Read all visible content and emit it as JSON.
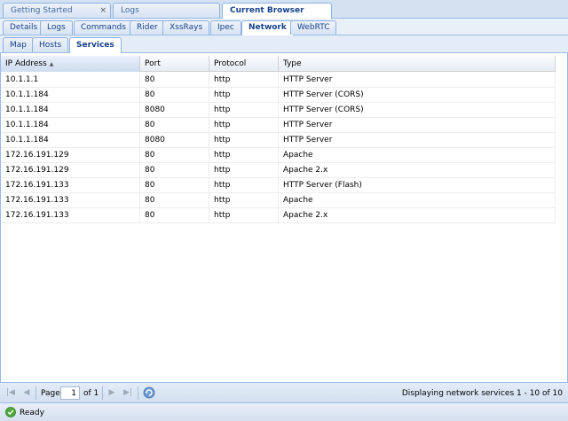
{
  "top_tabs": [
    {
      "label": "Getting Started",
      "close": "×"
    },
    {
      "label": "Logs"
    },
    {
      "label": "Current Browser"
    }
  ],
  "sub_tabs": [
    "Details",
    "Logs",
    "Commands",
    "Rider",
    "XssRays",
    "Ipec",
    "Network",
    "WebRTC"
  ],
  "section_tabs": [
    "Map",
    "Hosts",
    "Services"
  ],
  "grid": {
    "columns": [
      "IP Address",
      "Port",
      "Protocol",
      "Type"
    ],
    "sort_indicator": "▲",
    "rows": [
      [
        "10.1.1.1",
        "80",
        "http",
        "HTTP Server"
      ],
      [
        "10.1.1.184",
        "80",
        "http",
        "HTTP Server (CORS)"
      ],
      [
        "10.1.1.184",
        "8080",
        "http",
        "HTTP Server (CORS)"
      ],
      [
        "10.1.1.184",
        "80",
        "http",
        "HTTP Server"
      ],
      [
        "10.1.1.184",
        "8080",
        "http",
        "HTTP Server"
      ],
      [
        "172.16.191.129",
        "80",
        "http",
        "Apache"
      ],
      [
        "172.16.191.129",
        "80",
        "http",
        "Apache 2.x"
      ],
      [
        "172.16.191.133",
        "80",
        "http",
        "HTTP Server (Flash)"
      ],
      [
        "172.16.191.133",
        "80",
        "http",
        "Apache"
      ],
      [
        "172.16.191.133",
        "80",
        "http",
        "Apache 2.x"
      ]
    ]
  },
  "pager": {
    "page_label": "Page",
    "page_value": "1",
    "of_label": "of 1",
    "summary": "Displaying network services 1 - 10 of 10",
    "icons": {
      "first": "first-page-icon",
      "prev": "prev-page-icon",
      "next": "next-page-icon",
      "last": "last-page-icon",
      "refresh": "refresh-icon"
    }
  },
  "status": {
    "text": "Ready",
    "icon": "check-circle-icon"
  }
}
